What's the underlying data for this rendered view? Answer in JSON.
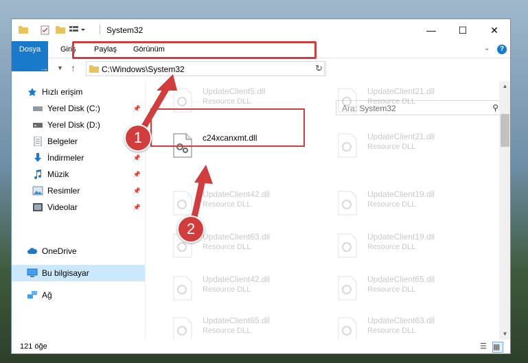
{
  "window": {
    "title": "System32",
    "controls": {
      "minimize": "—",
      "maximize": "☐",
      "close": "✕"
    }
  },
  "ribbon": {
    "tabs": [
      "Dosya",
      "Giriş",
      "Paylaş",
      "Görünüm"
    ],
    "help_icon": "?"
  },
  "address_bar": {
    "path": "C:\\Windows\\System32",
    "search_placeholder": "Ara: System32"
  },
  "sidebar": {
    "items": [
      {
        "label": "Hızlı erişim",
        "icon": "star-icon",
        "pinned": false,
        "selected": false
      },
      {
        "label": "Yerel Disk (C:)",
        "icon": "drive-icon",
        "pinned": true,
        "selected": false
      },
      {
        "label": "Yerel Disk (D:)",
        "icon": "drive-icon",
        "pinned": false,
        "selected": false
      },
      {
        "label": "Belgeler",
        "icon": "documents-icon",
        "pinned": false,
        "selected": false
      },
      {
        "label": "İndirmeler",
        "icon": "downloads-icon",
        "pinned": true,
        "selected": false
      },
      {
        "label": "Müzik",
        "icon": "music-icon",
        "pinned": true,
        "selected": false
      },
      {
        "label": "Resimler",
        "icon": "pictures-icon",
        "pinned": true,
        "selected": false
      },
      {
        "label": "Videolar",
        "icon": "videos-icon",
        "pinned": true,
        "selected": false
      },
      {
        "label": "OneDrive",
        "icon": "cloud-icon",
        "pinned": false,
        "selected": false
      },
      {
        "label": "Bu bilgisayar",
        "icon": "computer-icon",
        "pinned": false,
        "selected": true
      },
      {
        "label": "Ağ",
        "icon": "network-icon",
        "pinned": false,
        "selected": false
      }
    ]
  },
  "files": {
    "highlighted": {
      "name": "c24xcanxmt.dll"
    },
    "faded": [
      {
        "name": "UpdateClient5.dll",
        "type": "Resource DLL"
      },
      {
        "name": "UpdateClient21.dll",
        "type": "Resource DLL"
      },
      {
        "name": "UpdateClient21.dll",
        "type": "Resource DLL"
      },
      {
        "name": "UpdateClient42.dll",
        "type": "Resource DLL"
      },
      {
        "name": "UpdateClient19.dll",
        "type": "Resource DLL"
      },
      {
        "name": "UpdateClient63.dll",
        "type": "Resource DLL"
      },
      {
        "name": "UpdateClient19.dll",
        "type": "Resource DLL"
      },
      {
        "name": "UpdateClient42.dll",
        "type": "Resource DLL"
      },
      {
        "name": "UpdateClient65.dll",
        "type": "Resource DLL"
      },
      {
        "name": "UpdateClient65.dll",
        "type": "Resource DLL"
      },
      {
        "name": "UpdateClient63.dll",
        "type": "Resource DLL"
      }
    ]
  },
  "status": {
    "item_count": "121 öğe"
  },
  "annotations": {
    "step1": "1",
    "step2": "2",
    "color": "#d13c3c"
  }
}
